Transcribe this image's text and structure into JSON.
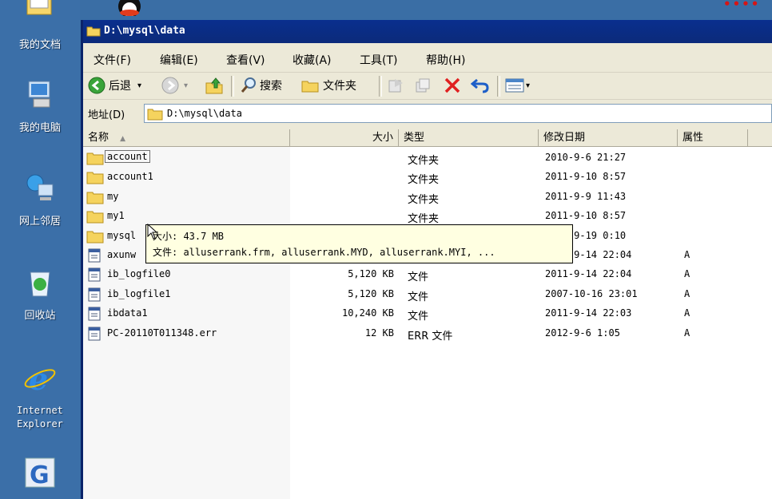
{
  "desktop": {
    "icons": [
      {
        "label": "我的文档",
        "icon": "my-documents-icon"
      },
      {
        "label": "我的电脑",
        "icon": "my-computer-icon"
      },
      {
        "label": "网上邻居",
        "icon": "network-places-icon"
      },
      {
        "label": "回收站",
        "icon": "recycle-bin-icon"
      },
      {
        "label": "Internet\nExplorer",
        "icon": "internet-explorer-icon"
      }
    ],
    "top_right_text": "••••"
  },
  "window": {
    "title": "D:\\mysql\\data",
    "menu": [
      "文件(F)",
      "编辑(E)",
      "查看(V)",
      "收藏(A)",
      "工具(T)",
      "帮助(H)"
    ],
    "toolbar": {
      "back": "后退",
      "search": "搜索",
      "folders": "文件夹"
    },
    "address": {
      "label": "地址(D)",
      "value": "D:\\mysql\\data"
    },
    "columns": [
      "名称",
      "大小",
      "类型",
      "修改日期",
      "属性"
    ],
    "files": [
      {
        "name": "account",
        "size": "",
        "type": "文件夹",
        "modified": "2010-9-6 21:27",
        "attr": "",
        "kind": "folder"
      },
      {
        "name": "account1",
        "size": "",
        "type": "文件夹",
        "modified": "2011-9-10 8:57",
        "attr": "",
        "kind": "folder"
      },
      {
        "name": "my",
        "size": "",
        "type": "文件夹",
        "modified": "2011-9-9 11:43",
        "attr": "",
        "kind": "folder"
      },
      {
        "name": "my1",
        "size": "",
        "type": "文件夹",
        "modified": "2011-9-10 8:57",
        "attr": "",
        "kind": "folder"
      },
      {
        "name": "mysql",
        "size": "",
        "type": "",
        "modified": "2011-9-19 0:10",
        "attr": "",
        "kind": "folder"
      },
      {
        "name": "axunw",
        "size": "",
        "type": "",
        "modified": "2011-9-14 22:04",
        "attr": "A",
        "kind": "file"
      },
      {
        "name": "ib_logfile0",
        "size": "5,120 KB",
        "type": "文件",
        "modified": "2011-9-14 22:04",
        "attr": "A",
        "kind": "file"
      },
      {
        "name": "ib_logfile1",
        "size": "5,120 KB",
        "type": "文件",
        "modified": "2007-10-16 23:01",
        "attr": "A",
        "kind": "file"
      },
      {
        "name": "ibdata1",
        "size": "10,240 KB",
        "type": "文件",
        "modified": "2011-9-14 22:03",
        "attr": "A",
        "kind": "file"
      },
      {
        "name": "PC-20110T011348.err",
        "size": "12 KB",
        "type": "ERR 文件",
        "modified": "2012-9-6 1:05",
        "attr": "A",
        "kind": "file"
      }
    ],
    "tooltip": {
      "size_line": "大小: 43.7 MB",
      "files_line": "文件: alluserrank.frm, alluserrank.MYD, alluserrank.MYI, ..."
    }
  },
  "colors": {
    "titlebar": "#0a2f8e",
    "desktop": "#3b6fa8",
    "tooltip": "#ffffe1",
    "folder": "#f5d35e"
  }
}
